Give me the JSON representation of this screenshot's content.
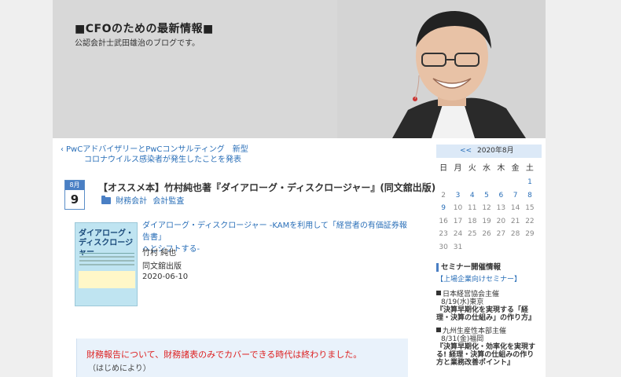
{
  "header": {
    "title": "■CFOのための最新情報■",
    "description": "公認会計士武田雄治のブログです。"
  },
  "nav": {
    "prev_chevron": "‹",
    "prev_line1": "PwCアドバイザリーとPwCコンサルティング　新型",
    "prev_line2": "コロナウイルス感染者が発生したことを発表"
  },
  "post": {
    "month": "8月",
    "day": "9",
    "title": "【オススメ本】竹村純也著『ダイアローグ・ディスクロージャー』(同文舘出版)",
    "categories": [
      "財務会計",
      "会計監査"
    ],
    "book": {
      "cover_title_line1": "ダイアローグ・",
      "cover_title_line2": "ディスクロージャー",
      "link_line1": "ダイアローグ・ディスクロージャー -KAMを利用して「経営者の有価証券報告書」",
      "link_line2": "へとシフトする-",
      "author": "竹村 純也",
      "publisher": "同文舘出版",
      "date": "2020-06-10"
    },
    "callout_line1": "財務報告について、財務諸表のみでカバーできる時代は終わりました。",
    "callout_line2": "（はじめにより）"
  },
  "calendar": {
    "prev": "<<",
    "year_month": "2020年8月",
    "weekdays": [
      "日",
      "月",
      "火",
      "水",
      "木",
      "金",
      "土"
    ],
    "weeks": [
      [
        "",
        "",
        "",
        "",
        "",
        "",
        "1"
      ],
      [
        "2",
        "3",
        "4",
        "5",
        "6",
        "7",
        "8"
      ],
      [
        "9",
        "10",
        "11",
        "12",
        "13",
        "14",
        "15"
      ],
      [
        "16",
        "17",
        "18",
        "19",
        "20",
        "21",
        "22"
      ],
      [
        "23",
        "24",
        "25",
        "26",
        "27",
        "28",
        "29"
      ],
      [
        "30",
        "31",
        "",
        "",
        "",
        "",
        ""
      ]
    ],
    "linked_days": [
      "1",
      "3",
      "4",
      "5",
      "6",
      "7",
      "8",
      "9"
    ]
  },
  "seminar": {
    "title": "セミナー開催情報",
    "listed_link": "【上場企業向けセミナー】",
    "item1_org": "日本経営協会主催",
    "item1_date": "8/19(水)東京",
    "item1_title_line1": "『決算早期化を実現する「経",
    "item1_title_line2": "理・決算の仕組み」の作り方』",
    "item2_org": "九州生産性本部主催",
    "item2_date": "8/31(金)福岡",
    "item2_title_line1": "『決算早期化・効率化を実現す",
    "item2_title_line2": "る! 経理・決算の仕組みの作り",
    "item2_title_line3": "方と業務改善ポイント』"
  }
}
